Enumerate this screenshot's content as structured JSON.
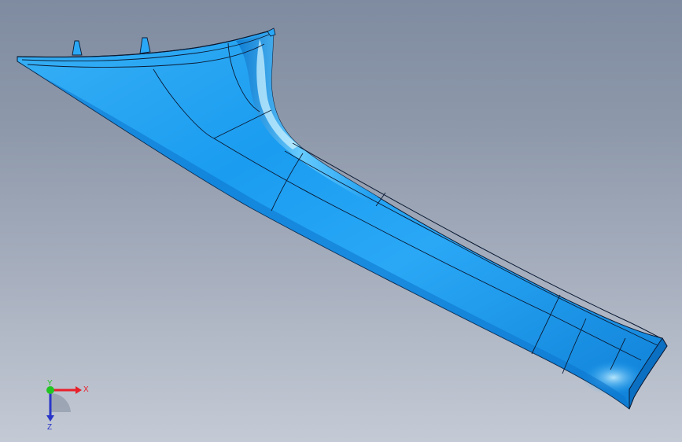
{
  "triad": {
    "x_label": "X",
    "y_label": "Y",
    "z_label": "Z",
    "x_color": "#e8202a",
    "y_color": "#22c422",
    "z_color": "#2a36c8"
  },
  "viewport": {
    "background_top": "#7f8ba0",
    "background_bottom": "#c4cad5"
  },
  "model": {
    "surface_color": "#1a9cf0",
    "highlight_color": "#8fd8ff",
    "shadow_color": "#0b6fc2",
    "edge_color": "#0a1a33"
  }
}
